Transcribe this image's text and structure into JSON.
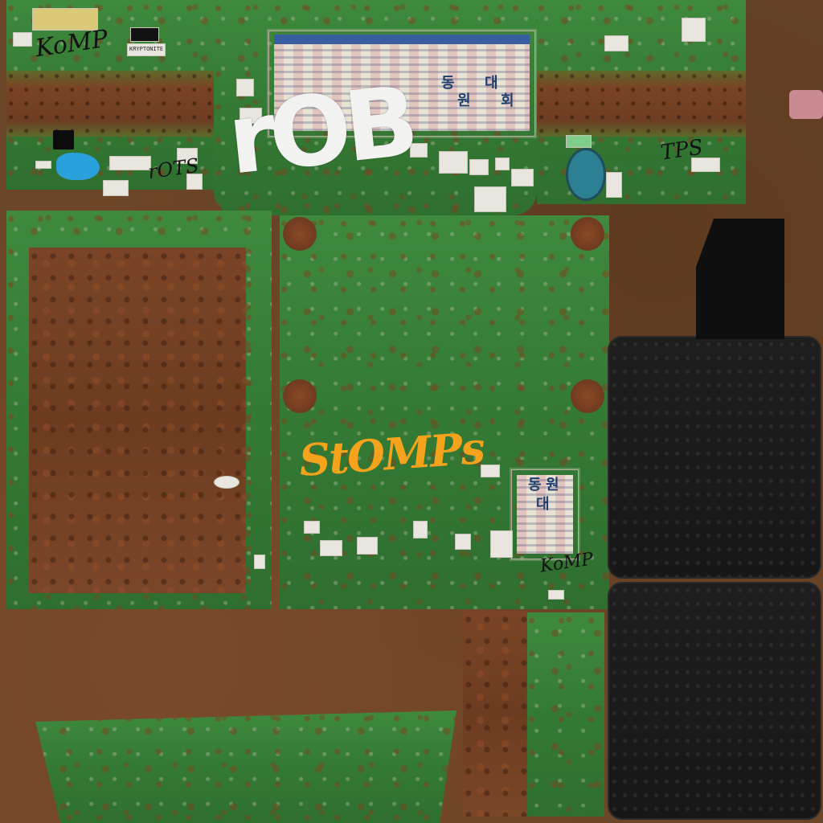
{
  "texture": {
    "graffiti_white": "rOB",
    "graffiti_orange": "StOMPs",
    "graffiti_black_1": "KoMP",
    "graffiti_black_2": "TPS",
    "graffiti_black_3": "rOTS",
    "graffiti_black_4": "KoMP",
    "poster_chars": [
      "동",
      "원",
      "대",
      "회",
      "동",
      "원",
      "대"
    ],
    "sticker_label_1": "KRYPTONITE",
    "colors": {
      "paint_green": "#3f8a3d",
      "rust": "#6d3c20",
      "rubber_black": "#171717",
      "graffiti_white": "#f2f2f0",
      "graffiti_orange": "#f5a21c",
      "poster_pink": "#e26a8e",
      "poster_blue": "#3a5fa0"
    }
  }
}
